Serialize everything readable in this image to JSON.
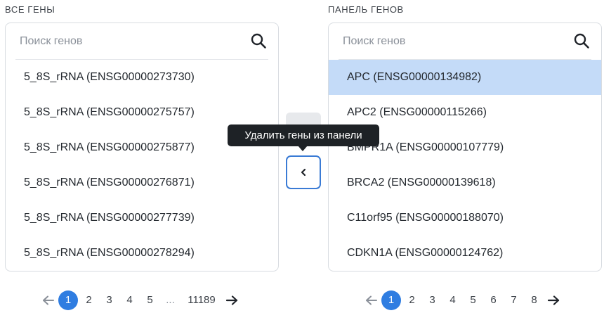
{
  "left_panel": {
    "label": "ВСЕ ГЕНЫ",
    "search_placeholder": "Поиск генов",
    "items": [
      "5_8S_rRNA (ENSG00000273730)",
      "5_8S_rRNA (ENSG00000275757)",
      "5_8S_rRNA (ENSG00000275877)",
      "5_8S_rRNA (ENSG00000276871)",
      "5_8S_rRNA (ENSG00000277739)",
      "5_8S_rRNA (ENSG00000278294)"
    ],
    "pagination": {
      "pages": [
        "1",
        "2",
        "3",
        "4",
        "5"
      ],
      "ellipsis": "...",
      "last_page": "11189",
      "current": "1"
    }
  },
  "right_panel": {
    "label": "ПАНЕЛЬ ГЕНОВ",
    "search_placeholder": "Поиск генов",
    "items": [
      "APC (ENSG00000134982)",
      "APC2 (ENSG00000115266)",
      "BMPR1A (ENSG00000107779)",
      "BRCA2 (ENSG00000139618)",
      "C11orf95 (ENSG00000188070)",
      "CDKN1A (ENSG00000124762)"
    ],
    "selected_index": 0,
    "pagination": {
      "pages": [
        "1",
        "2",
        "3",
        "4",
        "5",
        "6",
        "7",
        "8"
      ],
      "current": "1"
    }
  },
  "transfer": {
    "tooltip": "Удалить гены из панели",
    "move_icon": "chevron-left-icon"
  },
  "colors": {
    "accent": "#2f7de1",
    "selected_row": "#c4dbf8",
    "tooltip_bg": "#1e2226"
  }
}
